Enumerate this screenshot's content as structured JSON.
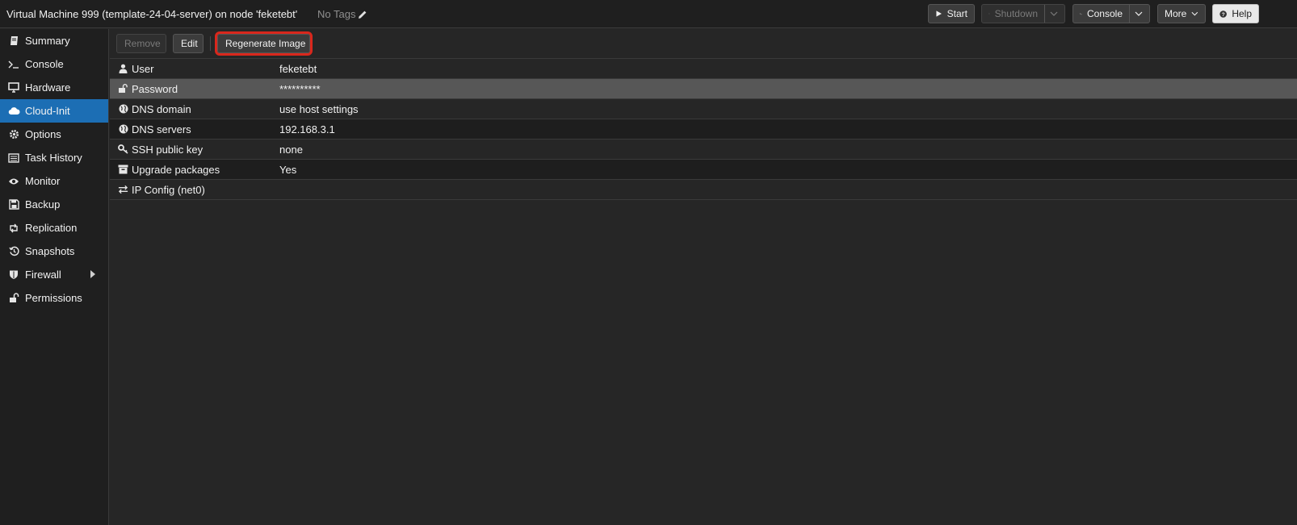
{
  "header": {
    "title": "Virtual Machine 999 (template-24-04-server) on node 'feketebt'",
    "tags_label": "No Tags",
    "buttons": {
      "start": "Start",
      "shutdown": "Shutdown",
      "console": "Console",
      "more": "More",
      "help": "Help"
    }
  },
  "sidebar": {
    "items": [
      {
        "label": "Summary",
        "icon": "book-icon"
      },
      {
        "label": "Console",
        "icon": "terminal-icon"
      },
      {
        "label": "Hardware",
        "icon": "monitor-icon"
      },
      {
        "label": "Cloud-Init",
        "icon": "cloud-icon",
        "active": true
      },
      {
        "label": "Options",
        "icon": "gear-icon"
      },
      {
        "label": "Task History",
        "icon": "list-icon"
      },
      {
        "label": "Monitor",
        "icon": "eye-icon"
      },
      {
        "label": "Backup",
        "icon": "floppy-icon"
      },
      {
        "label": "Replication",
        "icon": "retweet-icon"
      },
      {
        "label": "Snapshots",
        "icon": "history-icon"
      },
      {
        "label": "Firewall",
        "icon": "shield-icon"
      },
      {
        "label": "Permissions",
        "icon": "unlock-icon"
      }
    ]
  },
  "toolbar": {
    "remove": "Remove",
    "edit": "Edit",
    "regenerate": "Regenerate Image"
  },
  "grid": {
    "rows": [
      {
        "key": "User",
        "value": "feketebt",
        "icon": "user-icon"
      },
      {
        "key": "Password",
        "value": "**********",
        "icon": "unlock-icon",
        "selected": true
      },
      {
        "key": "DNS domain",
        "value": "use host settings",
        "icon": "globe-icon"
      },
      {
        "key": "DNS servers",
        "value": "192.168.3.1",
        "icon": "globe-icon"
      },
      {
        "key": "SSH public key",
        "value": "none",
        "icon": "key-icon"
      },
      {
        "key": "Upgrade packages",
        "value": "Yes",
        "icon": "archive-icon"
      },
      {
        "key": "IP Config (net0)",
        "value": "",
        "icon": "exchange-icon"
      }
    ]
  },
  "colors": {
    "accent": "#1c6eb4",
    "highlight_outline": "#d9271c",
    "background": "#262626"
  }
}
